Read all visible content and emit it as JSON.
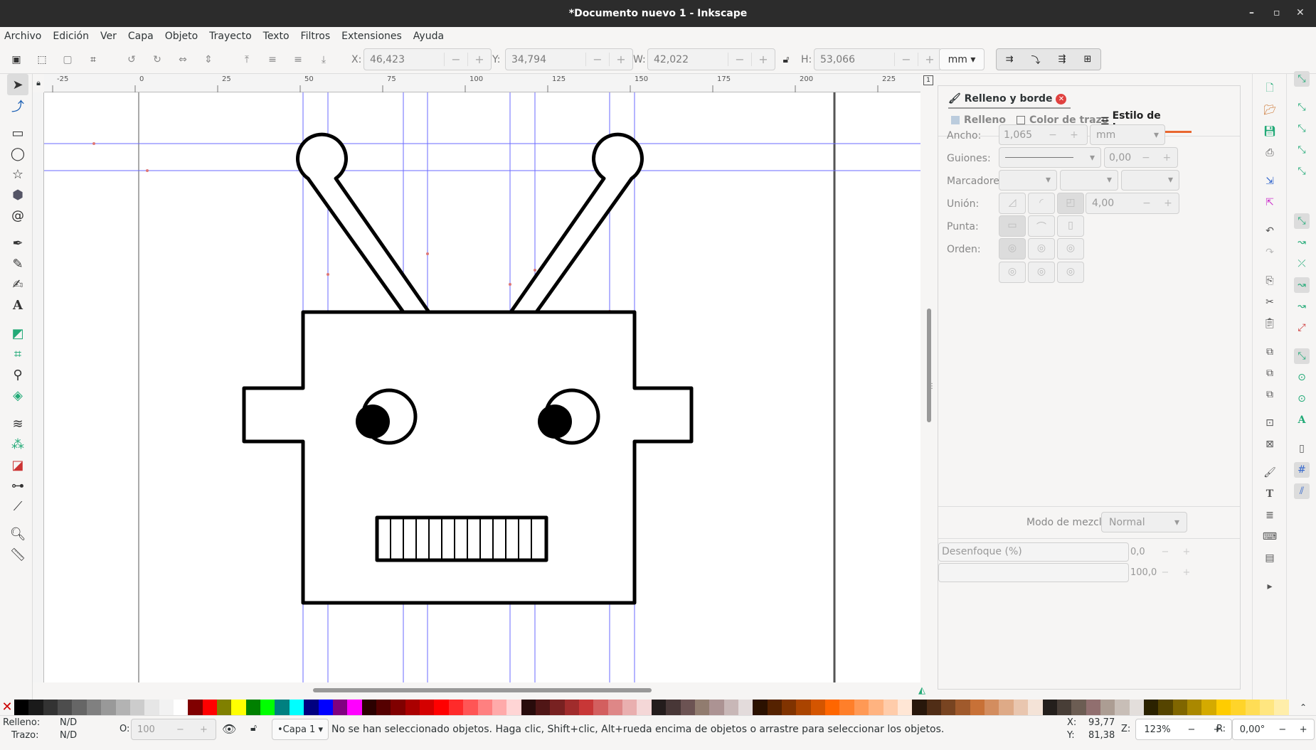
{
  "window": {
    "title": "*Documento nuevo 1 - Inkscape"
  },
  "menu": [
    "Archivo",
    "Edición",
    "Ver",
    "Capa",
    "Objeto",
    "Trayecto",
    "Texto",
    "Filtros",
    "Extensiones",
    "Ayuda"
  ],
  "toolbar": {
    "x_label": "X:",
    "x": "46,423",
    "y_label": "Y:",
    "y": "34,794",
    "w_label": "W:",
    "w": "42,022",
    "h_label": "H:",
    "h": "53,066",
    "unit": "mm"
  },
  "ruler": {
    "top": [
      "-25",
      "0",
      "25",
      "50",
      "75",
      "100",
      "125",
      "150",
      "175",
      "200",
      "225"
    ]
  },
  "panel": {
    "title": "Relleno y borde",
    "tabs": [
      "Relleno",
      "Color de trazo",
      "Estilo de trazo"
    ],
    "width_label": "Ancho:",
    "width_value": "1,065",
    "width_unit": "mm",
    "dashes_label": "Guiones:",
    "dashes_value": "0,00",
    "markers_label": "Marcadores:",
    "join_label": "Unión:",
    "miter_value": "4,00",
    "cap_label": "Punta:",
    "order_label": "Orden:",
    "blend_label": "Modo de mezcla:",
    "blend_value": "Normal",
    "blur_label": "Desenfoque (%)",
    "blur_value": "0,0",
    "opacity_value": "100,0"
  },
  "status": {
    "fill_label": "Relleno:",
    "fill_value": "N/D",
    "stroke_label": "Trazo:",
    "stroke_value": "N/D",
    "opacity_label": "O:",
    "opacity_value": "100",
    "layer": "•Capa 1",
    "message": "No se han seleccionado objetos. Haga clic, Shift+clic, Alt+rueda encima de objetos o arrastre para seleccionar los objetos.",
    "x_label": "X:",
    "x": "93,77",
    "y_label": "Y:",
    "y": "81,38",
    "zoom_label": "Z:",
    "zoom": "123%",
    "rot_label": "R:",
    "rotation": "0,00°"
  },
  "palette": [
    "#000000",
    "#1a1a1a",
    "#333333",
    "#4d4d4d",
    "#666666",
    "#808080",
    "#999999",
    "#b3b3b3",
    "#cccccc",
    "#e6e6e6",
    "#f2f2f2",
    "#ffffff",
    "#800000",
    "#ff0000",
    "#808000",
    "#ffff00",
    "#008000",
    "#00ff00",
    "#008080",
    "#00ffff",
    "#000080",
    "#0000ff",
    "#800080",
    "#ff00ff",
    "#2b0000",
    "#550000",
    "#800000",
    "#aa0000",
    "#d40000",
    "#ff0000",
    "#ff2a2a",
    "#ff5555",
    "#ff8080",
    "#ffaaaa",
    "#ffd5d5",
    "#280b0b",
    "#501616",
    "#782121",
    "#a02c2c",
    "#c83737",
    "#d35f5f",
    "#de8787",
    "#e9afaf",
    "#f4d7d7",
    "#241c1c",
    "#483737",
    "#6c5353",
    "#917c6f",
    "#ac9393",
    "#c8b7b7",
    "#e3dbdb",
    "#2b1100",
    "#552200",
    "#803300",
    "#aa4400",
    "#d45500",
    "#ff6600",
    "#ff7f2a",
    "#ff9955",
    "#ffb380",
    "#ffccaa",
    "#ffe6d5",
    "#28170b",
    "#502d16",
    "#784421",
    "#a05a2c",
    "#c87137",
    "#d38d5f",
    "#deaa87",
    "#e9c6af",
    "#f4e3d7",
    "#241f1c",
    "#483e37",
    "#6c5d53",
    "#916f6f",
    "#ac9d93",
    "#c8beb7",
    "#e3dedb",
    "#2b2200",
    "#554400",
    "#806600",
    "#aa8800",
    "#d4aa00",
    "#ffcc00",
    "#ffd42a",
    "#ffdd55",
    "#ffe680",
    "#ffeeaa"
  ]
}
